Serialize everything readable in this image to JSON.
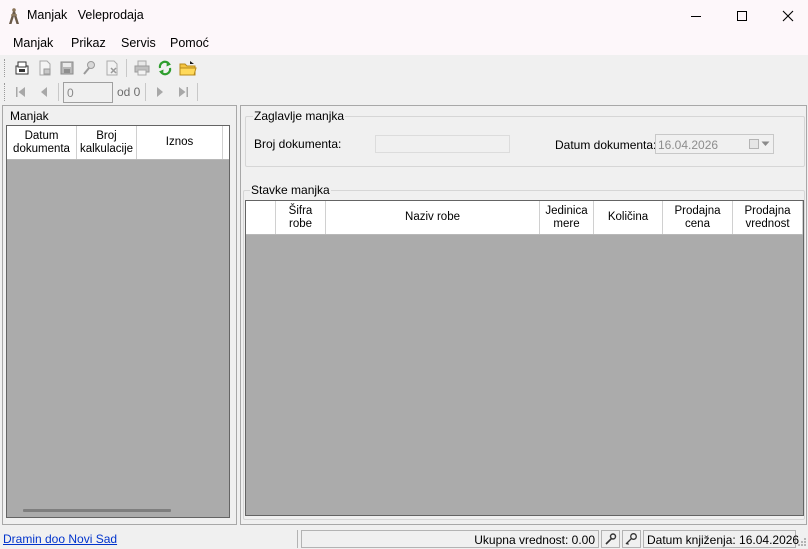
{
  "window": {
    "title": "Manjak   Veleprodaja",
    "minimize_icon": "minimize-icon",
    "maximize_icon": "maximize-icon",
    "close_icon": "close-icon"
  },
  "menu": [
    "Manjak",
    "Prikaz",
    "Servis",
    "Pomoć"
  ],
  "toolbar": {
    "icons": [
      "new-document-icon",
      "export-icon",
      "save-icon",
      "search-icon",
      "delete-icon",
      "print-icon",
      "refresh-icon",
      "open-folder-icon"
    ]
  },
  "navigator": {
    "position_value": "0",
    "of_label": "od 0",
    "icons": [
      "first-record-icon",
      "previous-record-icon",
      "next-record-icon",
      "last-record-icon"
    ]
  },
  "left_panel": {
    "title": "Manjak",
    "columns": [
      "Datum dokumenta",
      "Broj kalkulacije",
      "Iznos"
    ]
  },
  "header_group": {
    "title": "Zaglavlje manjka",
    "doc_number_label": "Broj dokumenta:",
    "doc_number_value": "",
    "doc_date_label": "Datum dokumenta:",
    "doc_date_value": "16.04.2026"
  },
  "items_group": {
    "title": "Stavke manjka",
    "columns": [
      "",
      "Šifra robe",
      "Naziv robe",
      "Jedinica mere",
      "Količina",
      "Prodajna cena",
      "Prodajna vrednost"
    ]
  },
  "status": {
    "company_link": "Dramin doo Novi Sad",
    "total_label": "Ukupna vrednost: 0.00",
    "booking_date": "Datum knjiženja: 16.04.2026"
  }
}
